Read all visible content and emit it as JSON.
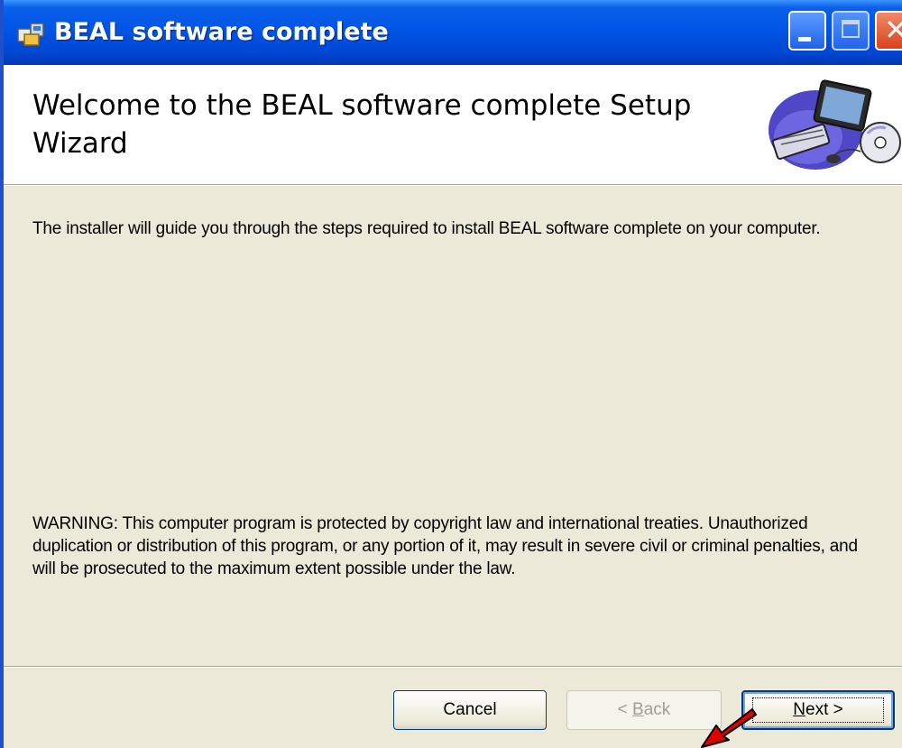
{
  "window": {
    "title": "BEAL software complete"
  },
  "banner": {
    "title": "Welcome to the BEAL software complete Setup Wizard",
    "art_icon": "computer-cd-icon"
  },
  "content": {
    "intro": "The installer will guide you through the steps required to install BEAL software complete on your computer.",
    "warning": "WARNING: This computer program is protected by copyright law and international treaties. Unauthorized duplication or distribution of this program, or any portion of it, may result in severe civil or criminal penalties, and will be prosecuted to the maximum extent possible under the law."
  },
  "buttons": {
    "cancel": "Cancel",
    "back_prefix": "< ",
    "back_mnemonic": "B",
    "back_rest": "ack",
    "next_mnemonic": "N",
    "next_rest": "ext >"
  },
  "annotation": {
    "arrow_color": "#e00000",
    "arrow_icon": "red-arrow-icon"
  },
  "colors": {
    "titlebar": "#0055e5",
    "dialog_bg": "#ece9d8",
    "close_button": "#d8421c"
  }
}
